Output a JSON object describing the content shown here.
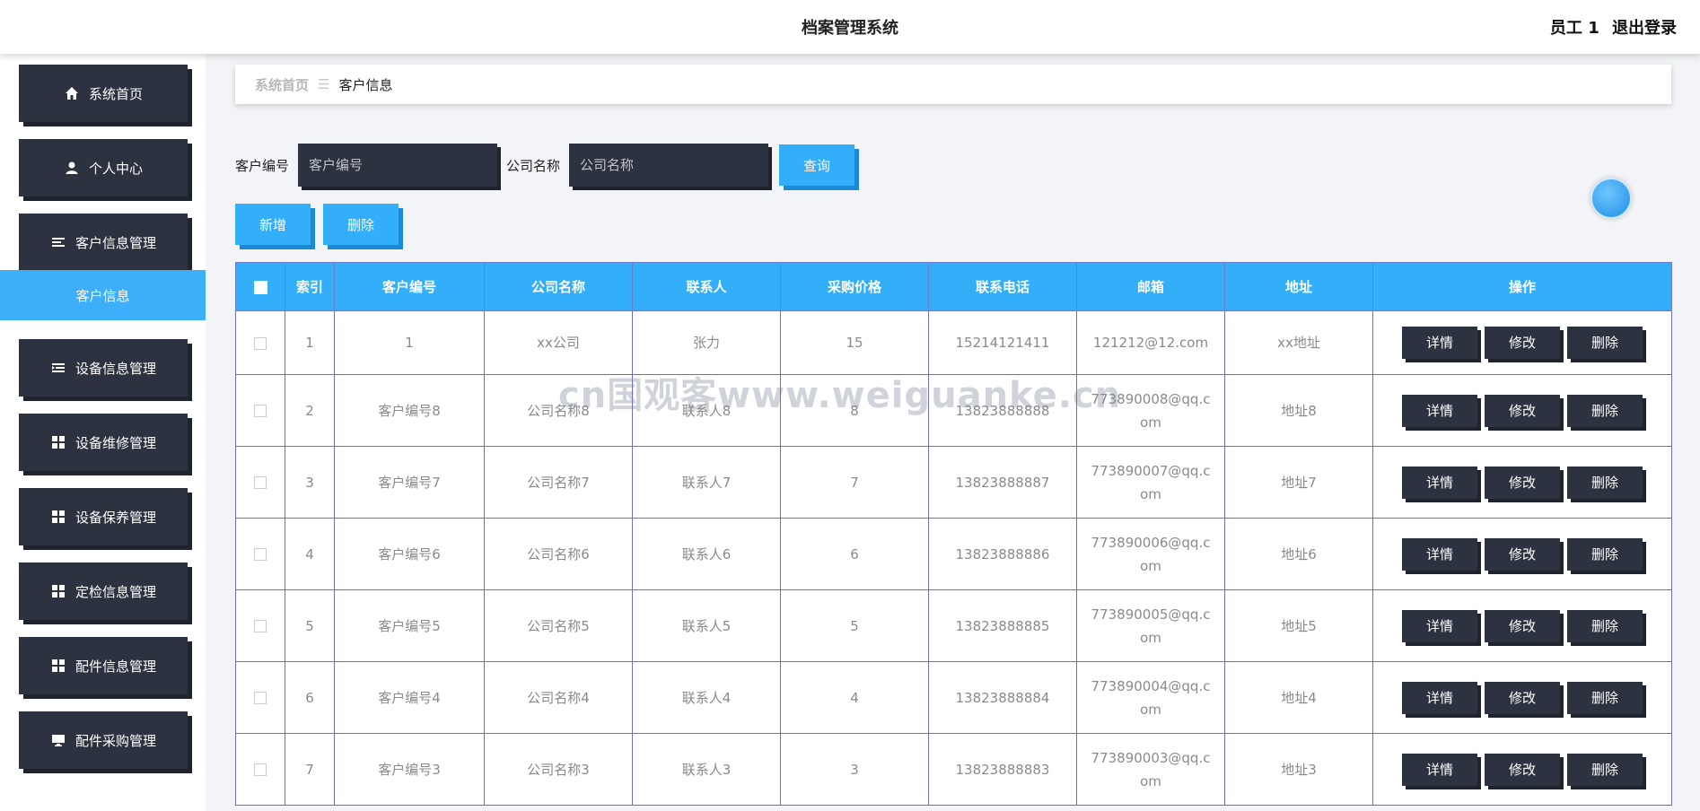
{
  "header": {
    "title": "档案管理系统",
    "user": "员工 1",
    "logout": "退出登录"
  },
  "sidebar": {
    "items": [
      {
        "label": "系统首页",
        "icon": "home-icon"
      },
      {
        "label": "个人中心",
        "icon": "user-icon"
      },
      {
        "label": "客户信息管理",
        "icon": "list-icon"
      },
      {
        "label": "客户信息",
        "icon": ""
      },
      {
        "label": "设备信息管理",
        "icon": "list-indent-icon"
      },
      {
        "label": "设备维修管理",
        "icon": "grid-icon"
      },
      {
        "label": "设备保养管理",
        "icon": "grid-icon"
      },
      {
        "label": "定检信息管理",
        "icon": "grid-icon"
      },
      {
        "label": "配件信息管理",
        "icon": "grid-icon"
      },
      {
        "label": "配件采购管理",
        "icon": "monitor-icon"
      }
    ]
  },
  "breadcrumb": {
    "home": "系统首页",
    "separator": "☰",
    "current": "客户信息"
  },
  "search": {
    "customer_no_label": "客户编号",
    "customer_no_placeholder": "客户编号",
    "company_label": "公司名称",
    "company_placeholder": "公司名称",
    "query_label": "查询"
  },
  "actions": {
    "add_label": "新增",
    "delete_label": "删除"
  },
  "table": {
    "columns": [
      "索引",
      "客户编号",
      "公司名称",
      "联系人",
      "采购价格",
      "联系电话",
      "邮箱",
      "地址",
      "操作"
    ],
    "row_buttons": {
      "detail": "详情",
      "edit": "修改",
      "delete": "删除"
    },
    "rows": [
      {
        "index": "1",
        "customer_no": "1",
        "company": "xx公司",
        "contact": "张力",
        "price": "15",
        "phone": "15214121411",
        "email": "121212@12.com",
        "address": "xx地址"
      },
      {
        "index": "2",
        "customer_no": "客户编号8",
        "company": "公司名称8",
        "contact": "联系人8",
        "price": "8",
        "phone": "13823888888",
        "email": "773890008@qq.com",
        "address": "地址8"
      },
      {
        "index": "3",
        "customer_no": "客户编号7",
        "company": "公司名称7",
        "contact": "联系人7",
        "price": "7",
        "phone": "13823888887",
        "email": "773890007@qq.com",
        "address": "地址7"
      },
      {
        "index": "4",
        "customer_no": "客户编号6",
        "company": "公司名称6",
        "contact": "联系人6",
        "price": "6",
        "phone": "13823888886",
        "email": "773890006@qq.com",
        "address": "地址6"
      },
      {
        "index": "5",
        "customer_no": "客户编号5",
        "company": "公司名称5",
        "contact": "联系人5",
        "price": "5",
        "phone": "13823888885",
        "email": "773890005@qq.com",
        "address": "地址5"
      },
      {
        "index": "6",
        "customer_no": "客户编号4",
        "company": "公司名称4",
        "contact": "联系人4",
        "price": "4",
        "phone": "13823888884",
        "email": "773890004@qq.com",
        "address": "地址4"
      },
      {
        "index": "7",
        "customer_no": "客户编号3",
        "company": "公司名称3",
        "contact": "联系人3",
        "price": "3",
        "phone": "13823888883",
        "email": "773890003@qq.com",
        "address": "地址3"
      }
    ]
  },
  "watermark": "cn国观客www.weiguanke.cn",
  "colors": {
    "accent": "#33aef8",
    "dark": "#2d3240"
  }
}
